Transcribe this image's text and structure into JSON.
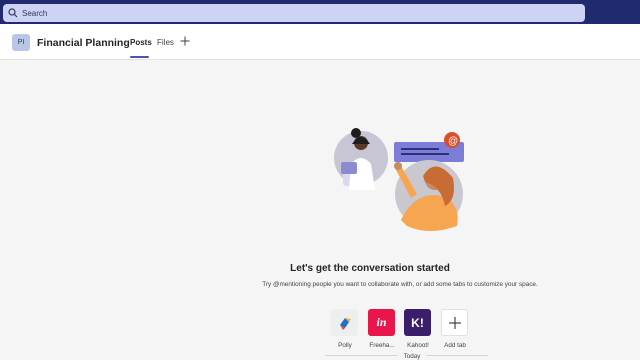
{
  "search": {
    "placeholder": "Search"
  },
  "header": {
    "avatar_initials": "PI",
    "team_name": "Financial Planning",
    "tabs": [
      {
        "label": "Posts",
        "active": true
      },
      {
        "label": "Files",
        "active": false
      }
    ]
  },
  "empty_state": {
    "title": "Let's get the conversation started",
    "subtitle": "Try @mentioning people you want to collaborate with, or add some tabs to customize your space."
  },
  "apps": [
    {
      "label": "Polly",
      "icon": "polly-icon"
    },
    {
      "label": "Freeha...",
      "icon": "invision-freehand-icon",
      "glyph": "in"
    },
    {
      "label": "Kahoot!",
      "icon": "kahoot-icon",
      "glyph": "K!"
    },
    {
      "label": "Add tab",
      "icon": "plus-icon"
    }
  ],
  "feed": {
    "date_divider": "Today"
  },
  "colors": {
    "topbar": "#1f2b6e",
    "accent": "#4f52b2",
    "freehand": "#e8164a",
    "kahoot": "#3a1d6b"
  }
}
